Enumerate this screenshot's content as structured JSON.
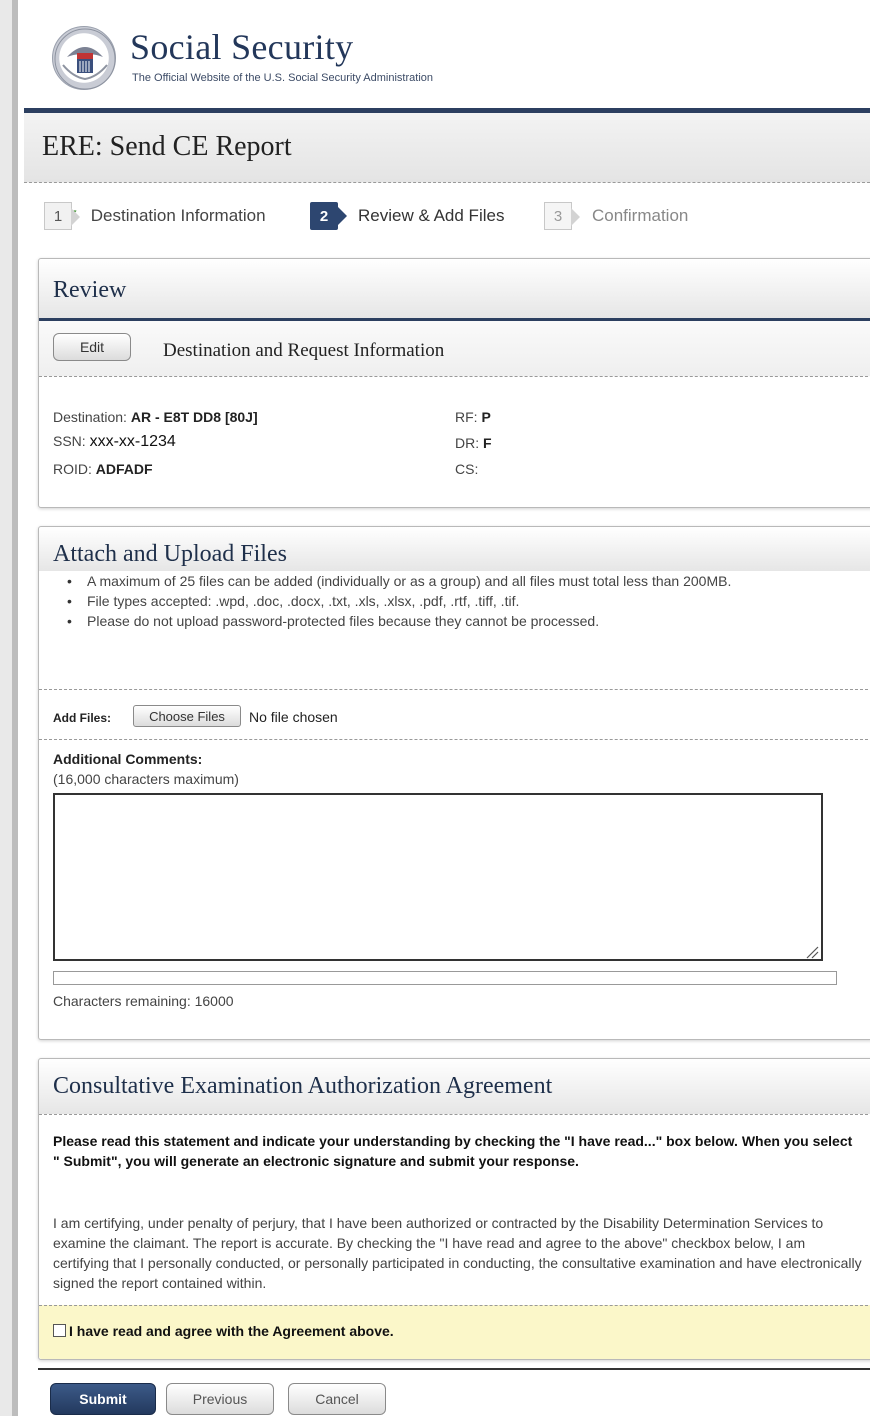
{
  "site": {
    "title": "Social Security",
    "subtitle": "The Official Website of the U.S. Social Security Administration",
    "seal_icon": "ssa-seal-icon"
  },
  "page": {
    "title": "ERE: Send CE Report"
  },
  "steps": [
    {
      "num": "1",
      "label": "Destination Information",
      "state": "done"
    },
    {
      "num": "2",
      "label": "Review & Add Files",
      "state": "active"
    },
    {
      "num": "3",
      "label": "Confirmation",
      "state": "todo"
    }
  ],
  "review": {
    "title": "Review",
    "edit_label": "Edit",
    "section_title": "Destination and Request Information",
    "fields": {
      "destination_label": "Destination:",
      "destination_value": "AR - E8T DD8 [80J]",
      "ssn_label": "SSN:",
      "ssn_value": "xxx-xx-1234",
      "roid_label": "ROID:",
      "roid_value": "ADFADF",
      "rf_label": "RF:",
      "rf_value": "P",
      "dr_label": "DR:",
      "dr_value": "F",
      "cs_label": "CS:",
      "cs_value": ""
    }
  },
  "attach": {
    "title": "Attach and Upload Files",
    "rules": [
      "A maximum of 25 files can be added (individually or as a group) and all files must total less than 200MB.",
      "File types accepted: .wpd, .doc, .docx, .txt, .xls, .xlsx, .pdf, .rtf, .tiff, .tif.",
      "Please do not upload password-protected files because they cannot be processed."
    ],
    "add_files_label": "Add Files:",
    "choose_label": "Choose Files",
    "no_file_text": "No file chosen",
    "comments_label": "Additional Comments:",
    "comments_hint": "(16,000 characters maximum)",
    "comments_value": "",
    "chars_remaining": "Characters remaining:  16000"
  },
  "agreement": {
    "title": "Consultative Examination Authorization Agreement",
    "instructions": "Please read this statement and indicate your understanding by checking the \"I have read...\" box below. When you select \" Submit\", you will generate an electronic signature and submit your response.",
    "text": "I am certifying, under penalty of perjury, that I have been authorized or contracted by the Disability Determination Services to examine the claimant. The report is accurate. By checking the \"I have read and agree to the above\" checkbox below, I am certifying that I personally conducted, or personally participated in conducting, the consultative examination and have electronically signed the report contained within.",
    "checkbox_label": "I have read and agree with the Agreement above.",
    "checked": false
  },
  "actions": {
    "submit": "Submit",
    "previous": "Previous",
    "cancel": "Cancel"
  },
  "colors": {
    "brand_navy": "#2c3f60",
    "agree_bg": "#fbf7c9",
    "check_green": "#3e8f2f"
  }
}
